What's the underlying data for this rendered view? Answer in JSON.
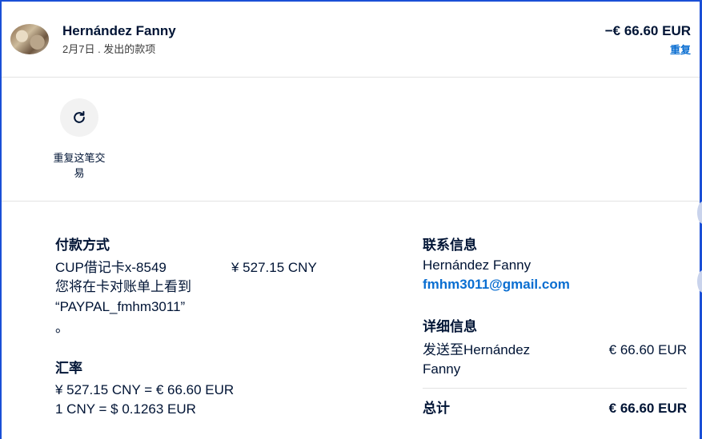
{
  "header": {
    "name": "Hernández Fanny",
    "subtitle": "2月7日 . 发出的款项",
    "amount": "−€ 66.60 EUR",
    "repeat_link": "重复"
  },
  "actions": {
    "repeat_label": "重复这笔交易"
  },
  "payment": {
    "title": "付款方式",
    "card": "CUP借记卡x-8549",
    "card_amount": "¥ 527.15 CNY",
    "statement_note_line1": "您将在卡对账单上看到",
    "statement_note_line2": "“PAYPAL_fmhm3011”",
    "statement_note_line3": "。"
  },
  "exchange": {
    "title": "汇率",
    "line1": "¥ 527.15 CNY = € 66.60 EUR",
    "line2": "1 CNY = $ 0.1263 EUR"
  },
  "contact": {
    "title": "联系信息",
    "name": "Hernández Fanny",
    "email": "fmhm3011@gmail.com"
  },
  "details": {
    "title": "详细信息",
    "sent_to_line1": "发送至Hernández",
    "sent_to_line2": "Fanny",
    "sent_amount": "€ 66.60 EUR",
    "total_label": "总计",
    "total_amount": "€ 66.60 EUR"
  },
  "colors": {
    "accent": "#0a6ed1",
    "frame": "#1a4fd6",
    "text": "#001435"
  }
}
